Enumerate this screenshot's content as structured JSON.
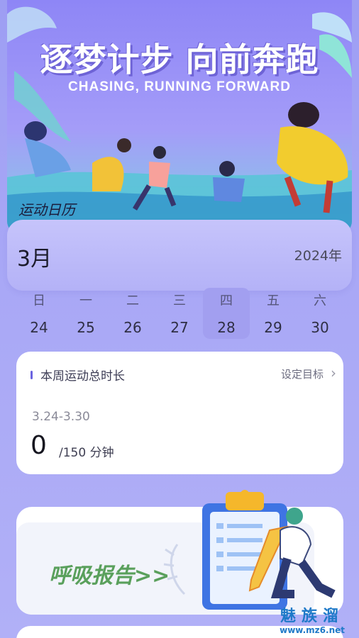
{
  "banner": {
    "title": "逐梦计步 向前奔跑",
    "subtitle": "CHASING, RUNNING FORWARD",
    "tag": "运动日历"
  },
  "calendar": {
    "month": "3月",
    "year": "2024年",
    "days": [
      {
        "weekday": "日",
        "date": "24"
      },
      {
        "weekday": "一",
        "date": "25"
      },
      {
        "weekday": "二",
        "date": "26"
      },
      {
        "weekday": "三",
        "date": "27"
      },
      {
        "weekday": "四",
        "date": "28"
      },
      {
        "weekday": "五",
        "date": "29"
      },
      {
        "weekday": "六",
        "date": "30"
      }
    ],
    "selected_date": "28"
  },
  "weekly": {
    "title": "本周运动总时长",
    "goal_label": "设定目标",
    "range": "3.24-3.30",
    "total": "0",
    "unit": "/150 分钟"
  },
  "breath": {
    "title": "呼吸报告>>"
  },
  "watermark": {
    "name": "魅族溜",
    "url": "www.mz6.net"
  },
  "colors": {
    "accent": "#6b64e0",
    "selected_day": "#a29ff0",
    "breath_green": "#5aa05c",
    "watermark_blue": "#1e79c8"
  }
}
